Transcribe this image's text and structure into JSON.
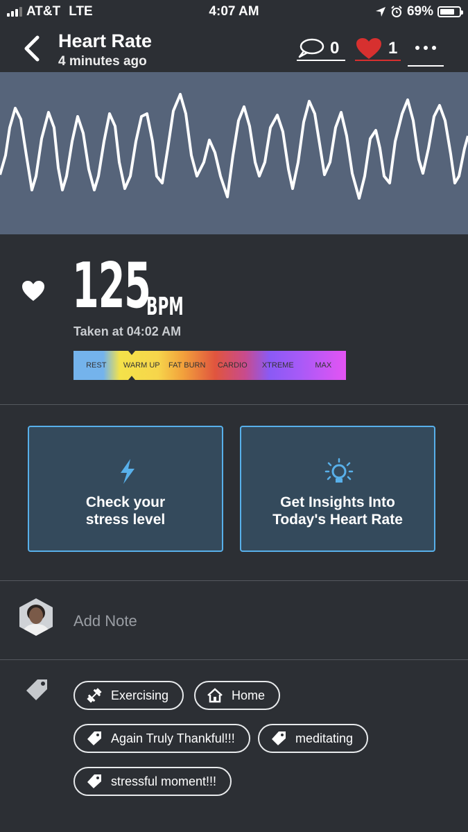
{
  "status": {
    "carrier": "AT&T",
    "network": "LTE",
    "time": "4:07 AM",
    "battery_percent": "69%",
    "battery_level": 0.69
  },
  "header": {
    "title": "Heart Rate",
    "subtitle": "4 minutes ago",
    "comment_count": "0",
    "like_count": "1"
  },
  "reading": {
    "bpm": "125",
    "unit": "BPM",
    "taken_at": "Taken at 04:02 AM",
    "zones": [
      "REST",
      "WARM UP",
      "FAT BURN",
      "CARDIO",
      "XTREME",
      "MAX"
    ],
    "current_zone": "WARM UP"
  },
  "cards": {
    "stress_label": "Check your\nstress level",
    "insights_label": "Get Insights Into\nToday's Heart Rate"
  },
  "note": {
    "placeholder": "Add Note"
  },
  "tags": [
    "Exercising",
    "Home",
    "Again Truly Thankful!!!",
    "meditating",
    "stressful moment!!!"
  ],
  "colors": {
    "background": "#2c2f34",
    "wave_panel": "#56647a",
    "accent_blue": "#58b0ea",
    "card_bg": "#344a5c",
    "like_red": "#d7302f"
  }
}
